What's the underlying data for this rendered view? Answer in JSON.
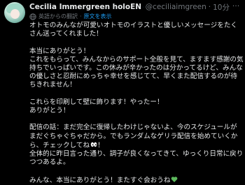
{
  "post": {
    "author_name": "Cecilia Immergreen",
    "author_org": "holoEN",
    "handle": "@ceciliaimgreen",
    "separator": "·",
    "time": "10分",
    "more_label": "···",
    "translate_label": "英語からの翻訳",
    "translate_sep": "·",
    "translate_link": "原文を表示"
  },
  "body": {
    "line1": "オトモのみんなが可愛いオトモのイラストと優しいメッセージをたくさん送ってくれました！",
    "line2": "本当にありがとう！",
    "line3": "これをもらって、みんなからのサポート全般を見て、ますます感謝の気持ちでいっぱいです。この休みが辛かったのは分かってるけど、みんなの優しさと忍耐にめっちゃ幸せを感じてて、早くまた配信するのが待ちきれません！",
    "line4": "これらを印刷して壁に飾ります！やったー！",
    "line5": "ありがとう！",
    "line6": "配信の話：まだ完全に復帰したわけじゃないよ、今のスケジュールがまだぐちゃぐちゃだから。でもランダムなゲリラ配信を始めていくから、チェックしてね",
    "line7": "！",
    "line8": "全体的に昨日言った通り、調子が良くなってきて、ゆっくり日常に戻りつつあるよ。",
    "line9": "みんな、本当にありがとう！またすぐ会おうね",
    "colors": {
      "background": "#000000",
      "text": "#e7e9ea",
      "muted": "#71767b",
      "link": "#1d9bf0",
      "verified": "#1d9bf0",
      "heart": "#5cb85c"
    }
  },
  "icons": {
    "org_badge": "green-heart-emoji-icon",
    "verified": "verified-badge-icon",
    "globe": "globe-icon",
    "eyes": "eyes-emoji-icon",
    "heart": "green-heart-emoji-icon"
  }
}
